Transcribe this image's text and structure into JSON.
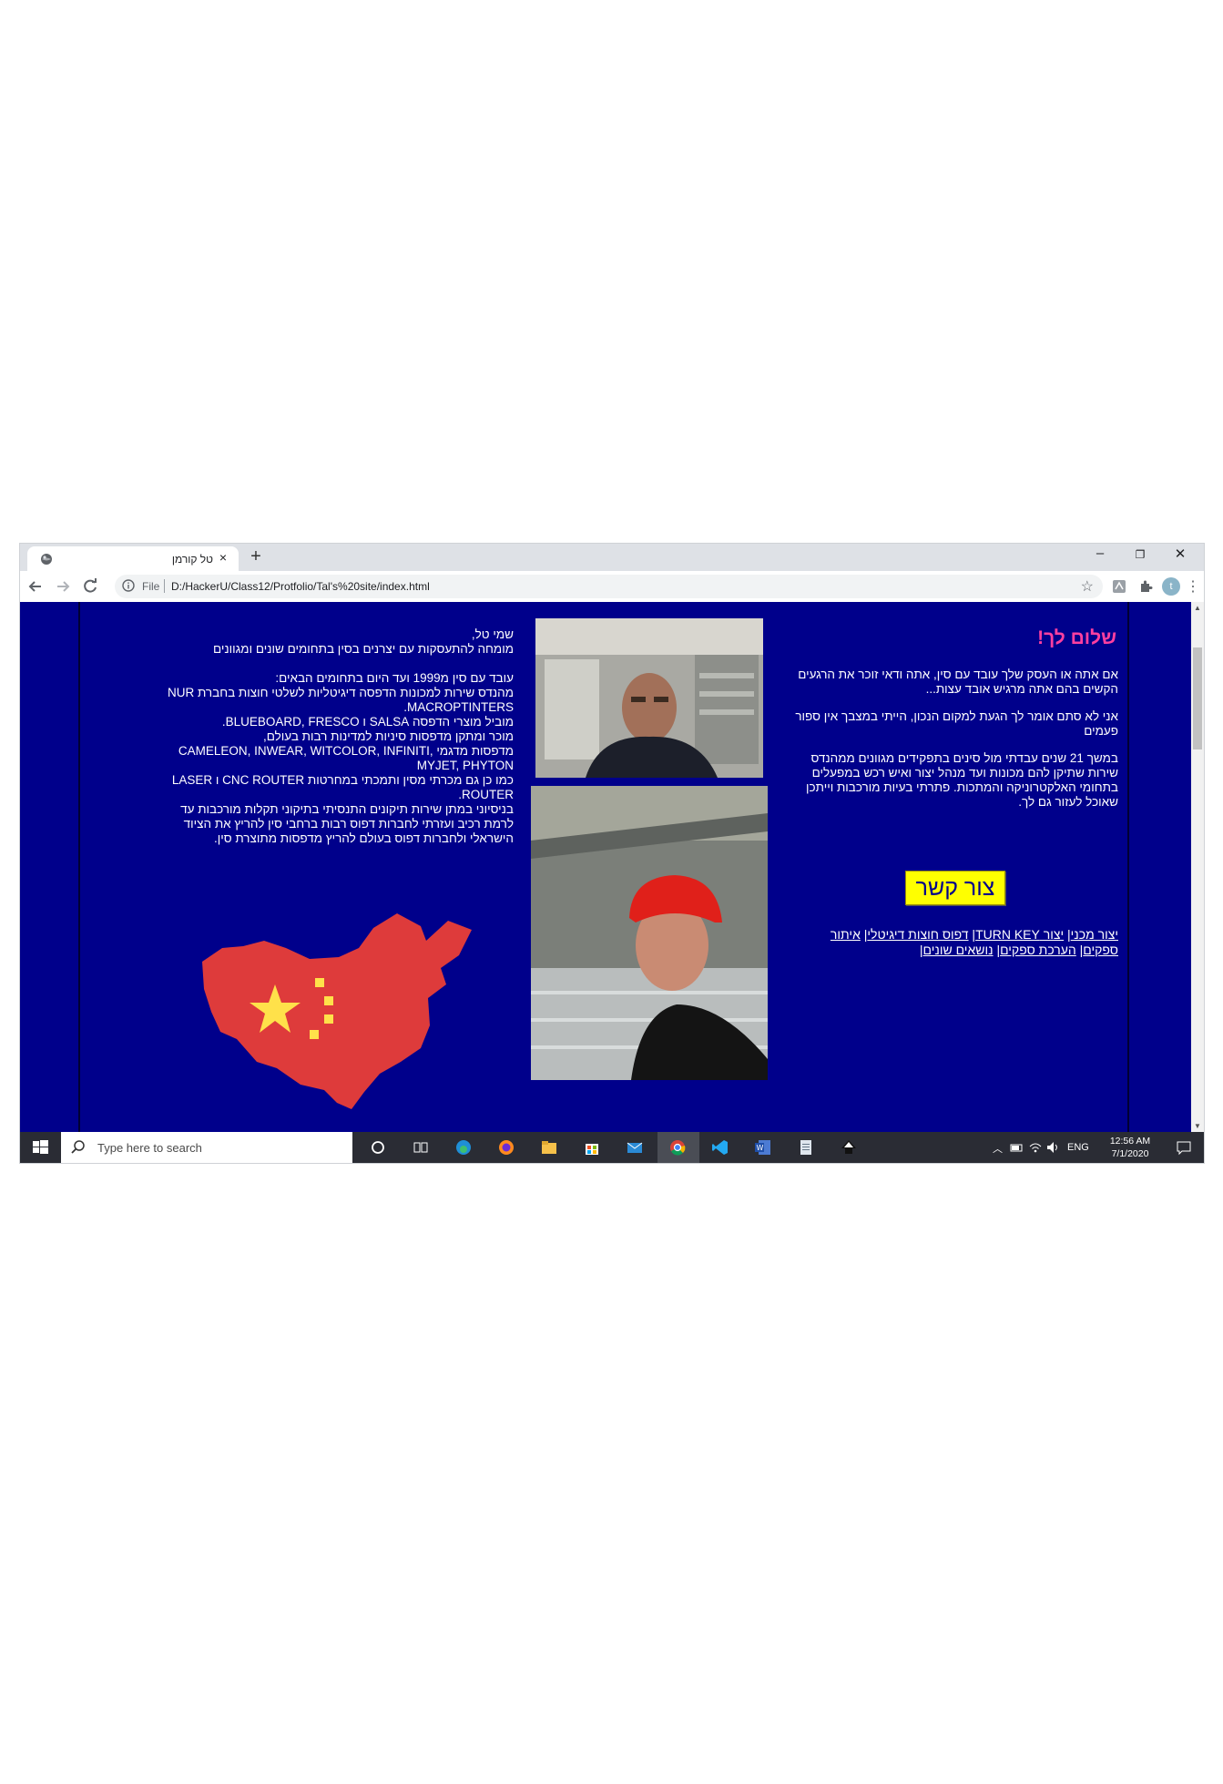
{
  "browser": {
    "tab_title": "טל קורמן",
    "tab_close": "×",
    "new_tab": "+",
    "minimize": "–",
    "restore": "❐",
    "close": "✕",
    "address_scheme": "File",
    "address_url": "D:/HackerU/Class12/Protfolio/Tal's%20site/index.html",
    "profile_initial": "t"
  },
  "page": {
    "greeting": "שלום לך!",
    "intro": [
      "אם אתה או העסק שלך עובד עם סין, אתה ודאי זוכר את הרגעים הקשים בהם אתה מרגיש אובד עצות...",
      "אני לא סתם אומר לך הגעת למקום הנכון, הייתי במצבך אין ספור פעמים",
      "במשך 21 שנים עבדתי מול סינים בתפקידים מגוונים ממהנדס שירות שתיקן להם מכונות ועד מנהל יצור ואיש רכש במפעלים בתחומי האלקטרוניקה והמתכות. פתרתי בעיות מורכבות וייתכן שאוכל לעזור גם לך."
    ],
    "contact_button": "צור קשר",
    "links": [
      "יצור מכני",
      "יצור TURN KEY",
      "דפוס חוצות דיגיטלי",
      "איתור ספקים",
      "הערכת ספקים",
      "נושאים שונים"
    ],
    "link_separator": "|",
    "about_1": [
      "שמי טל,",
      "מומחה להתעסקות עם יצרנים בסין בתחומים שונים ומגוונים"
    ],
    "about_2": [
      "עובד עם סין מ1999 ועד היום בתחומים הבאים:",
      "מהנדס שירות למכונות הדפסה דיגיטליות לשלטי חוצות בחברת NUR MACROPTINTERS.",
      "מוביל מוצרי הדפסה SALSA ו BLUEBOARD, FRESCO.",
      "מוכר ומתקן מדפסות סיניות למדינות רבות בעולם,",
      "מדפסות מדגמי CAMELEON, INWEAR, WITCOLOR, INFINITI, MYJET, PHYTON",
      "כמו כן גם מכרתי מסין ותמכתי במחרטות CNC ROUTER ו LASER ROUTER.",
      "בניסיוני במתן שירות תיקונים התנסיתי בתיקוני תקלות מורכבות עד לרמת רכיב ועזרתי לחברות דפוס רבות ברחבי סין להריץ את הציוד הישראלי ולחברות דפוס בעולם להריץ מדפסות מתוצרת סין."
    ]
  },
  "taskbar": {
    "search_placeholder": "Type here to search",
    "language": "ENG",
    "time": "12:56 AM",
    "date": "7/1/2020"
  },
  "colors": {
    "page_bg": "#00008b",
    "greeting": "#ff3fa0",
    "contact_bg": "#ffff00",
    "china_red": "#de3b3b",
    "china_star": "#ffe14a"
  }
}
